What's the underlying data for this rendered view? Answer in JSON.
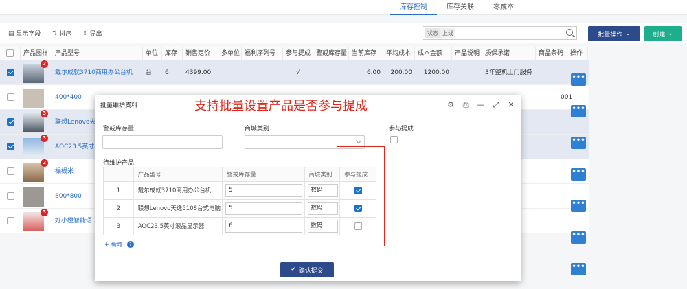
{
  "tabs": [
    "库存控制",
    "库存关联",
    "零成本"
  ],
  "toolbar": {
    "fields_label": "显示字段",
    "sort_label": "排序",
    "export_label": "导出",
    "search_tag_status": "状态",
    "search_tag_online": "上线",
    "batch_label": "批量操作",
    "create_label": "创建"
  },
  "table": {
    "headers": [
      "产品图样",
      "产品型号",
      "单位",
      "库存",
      "销售定价",
      "多单位",
      "福利序列号",
      "参与提成",
      "警戒库存量",
      "当前库存",
      "平均成本",
      "成本金额",
      "产品说明",
      "质保承诺",
      "商品条码",
      "操作"
    ],
    "rows": [
      {
        "selected": true,
        "badge": "2",
        "model": "戴尔成就3710商用办公台机",
        "unit": "台",
        "stock": "6",
        "price": "4399.00",
        "commission": "√",
        "current": "6.00",
        "avg": "200.00",
        "amount": "1200.00",
        "warranty": "3年整机上门服务",
        "barcode": ""
      },
      {
        "selected": false,
        "badge": "",
        "model": "400*400",
        "unit": "",
        "stock": "",
        "price": "",
        "commission": "",
        "current": "",
        "avg": "",
        "amount": "",
        "warranty": "",
        "barcode": "001"
      },
      {
        "selected": true,
        "badge": "3",
        "model": "联想Lenovo天",
        "unit": "",
        "stock": "",
        "price": "",
        "commission": "",
        "current": "",
        "avg": "",
        "amount": "",
        "warranty": "",
        "barcode": ""
      },
      {
        "selected": true,
        "badge": "3",
        "model": "AOC23.5英寸",
        "unit": "",
        "stock": "",
        "price": "",
        "commission": "",
        "current": "",
        "avg": "",
        "amount": "",
        "warranty": "",
        "barcode": ""
      },
      {
        "selected": false,
        "badge": "2",
        "model": "榻榻米",
        "unit": "",
        "stock": "",
        "price": "",
        "commission": "",
        "current": "",
        "avg": "",
        "amount": "",
        "warranty": "",
        "barcode": ""
      },
      {
        "selected": false,
        "badge": "",
        "model": "800*800",
        "unit": "",
        "stock": "",
        "price": "",
        "commission": "",
        "current": "",
        "avg": "",
        "amount": "",
        "warranty": "",
        "barcode": ""
      },
      {
        "selected": false,
        "badge": "3",
        "model": "好小橙智能语",
        "unit": "",
        "stock": "",
        "price": "",
        "commission": "",
        "current": "",
        "avg": "",
        "amount": "",
        "warranty": "",
        "barcode": ""
      }
    ],
    "op_label": "•••"
  },
  "modal": {
    "title": "批量维护资料",
    "annotation": "支持批量设置产品是否参与提成",
    "warn_stock_label": "警戒库存量",
    "category_label": "商城类别",
    "commission_label": "参与提成",
    "pending_label": "待维护产品",
    "sub_headers": [
      "产品型号",
      "警戒库存量",
      "商城类别",
      "参与提成"
    ],
    "sub_rows": [
      {
        "idx": "1",
        "model": "戴尔成就3710商用办公台机",
        "stock": "5",
        "category": "数码",
        "checked": true
      },
      {
        "idx": "2",
        "model": "联想Lenovo天逸510S台式电脑",
        "stock": "5",
        "category": "数码",
        "checked": true
      },
      {
        "idx": "3",
        "model": "AOC23.5英寸液晶显示器",
        "stock": "6",
        "category": "数码",
        "checked": false
      }
    ],
    "add_label": "+ 新增",
    "help_label": "?",
    "submit_label": "确认提交"
  },
  "colors": {
    "accent": "#2a6fc6",
    "batch": "#2d4a8a",
    "create": "#1eae8e",
    "annotation": "#e0261b"
  }
}
